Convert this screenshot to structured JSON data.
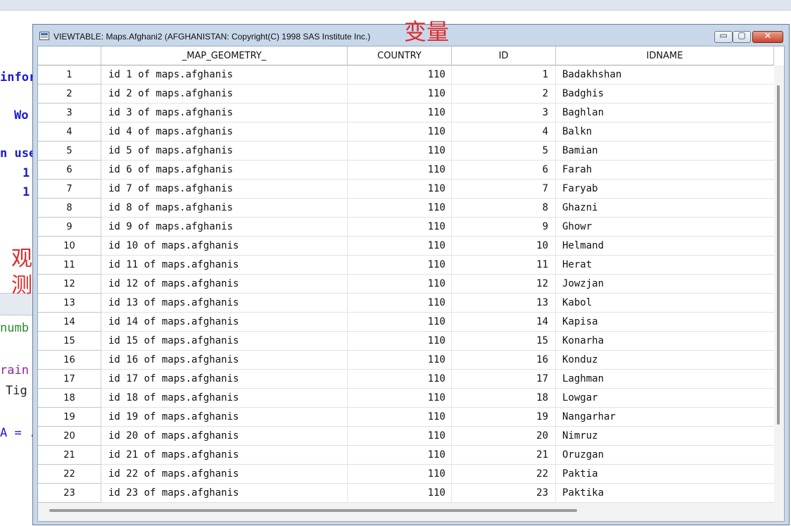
{
  "background": {
    "code_fragments": [
      "infor",
      "Wo",
      "n use",
      "1",
      "1",
      "numb",
      "rain",
      "Tig",
      "A = ."
    ],
    "annotations": {
      "top": "变量",
      "left_line1": "观",
      "left_line2": "测"
    }
  },
  "window": {
    "title": "VIEWTABLE: Maps.Afghani2 (AFGHANISTAN: Copyright(C) 1998 SAS Institute Inc.)",
    "controls": {
      "minimize": "▭",
      "maximize": "▢",
      "close": "✕"
    }
  },
  "table": {
    "columns": [
      "_MAP_GEOMETRY_",
      "COUNTRY",
      "ID",
      "IDNAME"
    ],
    "rows": [
      {
        "num": "1",
        "geometry": "id 1 of maps.afghanis",
        "country": "110",
        "id": "1",
        "idname": "Badakhshan"
      },
      {
        "num": "2",
        "geometry": "id 2 of maps.afghanis",
        "country": "110",
        "id": "2",
        "idname": "Badghis"
      },
      {
        "num": "3",
        "geometry": "id 3 of maps.afghanis",
        "country": "110",
        "id": "3",
        "idname": "Baghlan"
      },
      {
        "num": "4",
        "geometry": "id 4 of maps.afghanis",
        "country": "110",
        "id": "4",
        "idname": "Balkn"
      },
      {
        "num": "5",
        "geometry": "id 5 of maps.afghanis",
        "country": "110",
        "id": "5",
        "idname": "Bamian"
      },
      {
        "num": "6",
        "geometry": "id 6 of maps.afghanis",
        "country": "110",
        "id": "6",
        "idname": "Farah"
      },
      {
        "num": "7",
        "geometry": "id 7 of maps.afghanis",
        "country": "110",
        "id": "7",
        "idname": "Faryab"
      },
      {
        "num": "8",
        "geometry": "id 8 of maps.afghanis",
        "country": "110",
        "id": "8",
        "idname": "Ghazni"
      },
      {
        "num": "9",
        "geometry": "id 9 of maps.afghanis",
        "country": "110",
        "id": "9",
        "idname": "Ghowr"
      },
      {
        "num": "10",
        "geometry": "id 10 of maps.afghanis",
        "country": "110",
        "id": "10",
        "idname": "Helmand"
      },
      {
        "num": "11",
        "geometry": "id 11 of maps.afghanis",
        "country": "110",
        "id": "11",
        "idname": "Herat"
      },
      {
        "num": "12",
        "geometry": "id 12 of maps.afghanis",
        "country": "110",
        "id": "12",
        "idname": "Jowzjan"
      },
      {
        "num": "13",
        "geometry": "id 13 of maps.afghanis",
        "country": "110",
        "id": "13",
        "idname": "Kabol"
      },
      {
        "num": "14",
        "geometry": "id 14 of maps.afghanis",
        "country": "110",
        "id": "14",
        "idname": "Kapisa"
      },
      {
        "num": "15",
        "geometry": "id 15 of maps.afghanis",
        "country": "110",
        "id": "15",
        "idname": "Konarha"
      },
      {
        "num": "16",
        "geometry": "id 16 of maps.afghanis",
        "country": "110",
        "id": "16",
        "idname": "Konduz"
      },
      {
        "num": "17",
        "geometry": "id 17 of maps.afghanis",
        "country": "110",
        "id": "17",
        "idname": "Laghman"
      },
      {
        "num": "18",
        "geometry": "id 18 of maps.afghanis",
        "country": "110",
        "id": "18",
        "idname": "Lowgar"
      },
      {
        "num": "19",
        "geometry": "id 19 of maps.afghanis",
        "country": "110",
        "id": "19",
        "idname": "Nangarhar"
      },
      {
        "num": "20",
        "geometry": "id 20 of maps.afghanis",
        "country": "110",
        "id": "20",
        "idname": "Nimruz"
      },
      {
        "num": "21",
        "geometry": "id 21 of maps.afghanis",
        "country": "110",
        "id": "21",
        "idname": "Oruzgan"
      },
      {
        "num": "22",
        "geometry": "id 22 of maps.afghanis",
        "country": "110",
        "id": "22",
        "idname": "Paktia"
      },
      {
        "num": "23",
        "geometry": "id 23 of maps.afghanis",
        "country": "110",
        "id": "23",
        "idname": "Paktika"
      }
    ]
  }
}
